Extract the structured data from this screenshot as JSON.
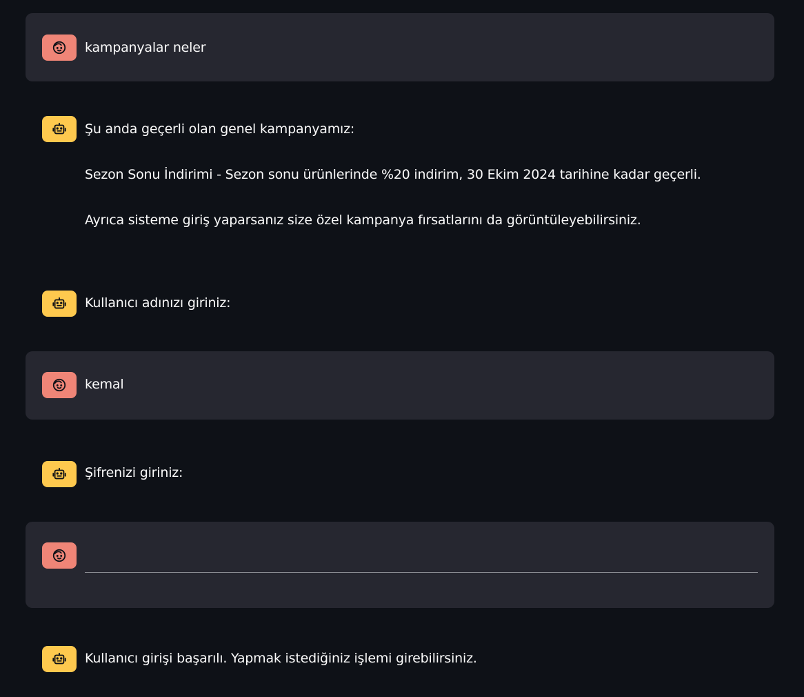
{
  "colors": {
    "background": "#0e1117",
    "user_bubble": "#262730",
    "user_avatar": "#ef8577",
    "bot_avatar": "#fec94e",
    "text": "#fafafa"
  },
  "icons": {
    "user": "user-face-icon",
    "assistant": "robot-icon"
  },
  "messages": [
    {
      "role": "user",
      "text": "kampanyalar neler"
    },
    {
      "role": "assistant",
      "paragraphs": [
        "Şu anda geçerli olan genel kampanyamız:",
        "Sezon Sonu İndirimi - Sezon sonu ürünlerinde %20 indirim, 30 Ekim 2024 tarihine kadar geçerli.",
        "Ayrıca sisteme giriş yaparsanız size özel kampanya fırsatlarını da görüntüleyebilirsiniz."
      ]
    },
    {
      "role": "assistant",
      "text": "Kullanıcı adınızı giriniz:"
    },
    {
      "role": "user",
      "text": "kemal"
    },
    {
      "role": "assistant",
      "text": "Şifrenizi giriniz:"
    },
    {
      "role": "user",
      "input": {
        "value": "",
        "placeholder": ""
      }
    },
    {
      "role": "assistant",
      "text": "Kullanıcı girişi başarılı. Yapmak istediğiniz işlemi girebilirsiniz."
    }
  ]
}
